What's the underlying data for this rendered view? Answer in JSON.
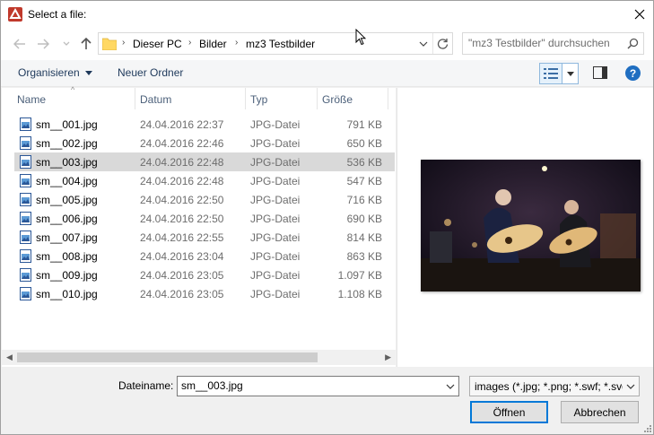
{
  "window": {
    "title": "Select a file:"
  },
  "nav": {
    "breadcrumbs": [
      "Dieser PC",
      "Bilder",
      "mz3 Testbilder"
    ]
  },
  "search": {
    "placeholder": "\"mz3 Testbilder\" durchsuchen"
  },
  "toolbar": {
    "organize_label": "Organisieren",
    "new_folder_label": "Neuer Ordner",
    "help_label": "?"
  },
  "columns": {
    "name": "Name",
    "date": "Datum",
    "type": "Typ",
    "size": "Größe"
  },
  "files": [
    {
      "name": "sm__001.jpg",
      "date": "24.04.2016 22:37",
      "type": "JPG-Datei",
      "size": "791 KB",
      "selected": false
    },
    {
      "name": "sm__002.jpg",
      "date": "24.04.2016 22:46",
      "type": "JPG-Datei",
      "size": "650 KB",
      "selected": false
    },
    {
      "name": "sm__003.jpg",
      "date": "24.04.2016 22:48",
      "type": "JPG-Datei",
      "size": "536 KB",
      "selected": true
    },
    {
      "name": "sm__004.jpg",
      "date": "24.04.2016 22:48",
      "type": "JPG-Datei",
      "size": "547 KB",
      "selected": false
    },
    {
      "name": "sm__005.jpg",
      "date": "24.04.2016 22:50",
      "type": "JPG-Datei",
      "size": "716 KB",
      "selected": false
    },
    {
      "name": "sm__006.jpg",
      "date": "24.04.2016 22:50",
      "type": "JPG-Datei",
      "size": "690 KB",
      "selected": false
    },
    {
      "name": "sm__007.jpg",
      "date": "24.04.2016 22:55",
      "type": "JPG-Datei",
      "size": "814 KB",
      "selected": false
    },
    {
      "name": "sm__008.jpg",
      "date": "24.04.2016 23:04",
      "type": "JPG-Datei",
      "size": "863 KB",
      "selected": false
    },
    {
      "name": "sm__009.jpg",
      "date": "24.04.2016 23:05",
      "type": "JPG-Datei",
      "size": "1.097 KB",
      "selected": false
    },
    {
      "name": "sm__010.jpg",
      "date": "24.04.2016 23:05",
      "type": "JPG-Datei",
      "size": "1.108 KB",
      "selected": false
    }
  ],
  "footer": {
    "filename_label": "Dateiname:",
    "filename_value": "sm__003.jpg",
    "filetype_value": "images (*.jpg; *.png; *.swf; *.svg",
    "open_label": "Öffnen",
    "cancel_label": "Abbrechen"
  },
  "colors": {
    "accent": "#0078d7",
    "selected_row": "#d9d9d9",
    "help_icon": "#1f6ec1"
  }
}
